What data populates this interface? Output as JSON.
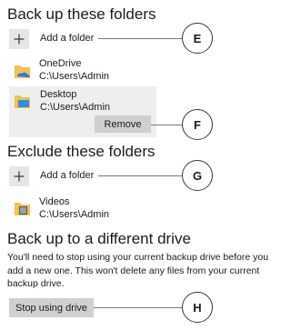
{
  "backup_section": {
    "title": "Back up these folders",
    "add_label": "Add a folder",
    "folders": [
      {
        "name": "OneDrive",
        "path": "C:\\Users\\Admin"
      },
      {
        "name": "Desktop",
        "path": "C:\\Users\\Admin"
      }
    ],
    "remove_label": "Remove"
  },
  "exclude_section": {
    "title": "Exclude these folders",
    "add_label": "Add a folder",
    "folders": [
      {
        "name": "Videos",
        "path": "C:\\Users\\Admin"
      }
    ]
  },
  "different_drive": {
    "title": "Back up to a different drive",
    "description": "You'll need to stop using your current backup drive before you add a new one. This won't delete any files from your current backup drive.",
    "stop_label": "Stop using drive"
  },
  "callouts": [
    "E",
    "F",
    "G",
    "H"
  ],
  "icons": {
    "add": "plus-icon",
    "onedrive": "onedrive-folder-icon",
    "desktop": "desktop-folder-icon",
    "videos": "videos-folder-icon"
  },
  "colors": {
    "button_bg": "#cfcfcf",
    "highlight_bg": "#eeeeee",
    "folder_yellow": "#f2c14e",
    "accent_blue": "#2b7bd6"
  }
}
